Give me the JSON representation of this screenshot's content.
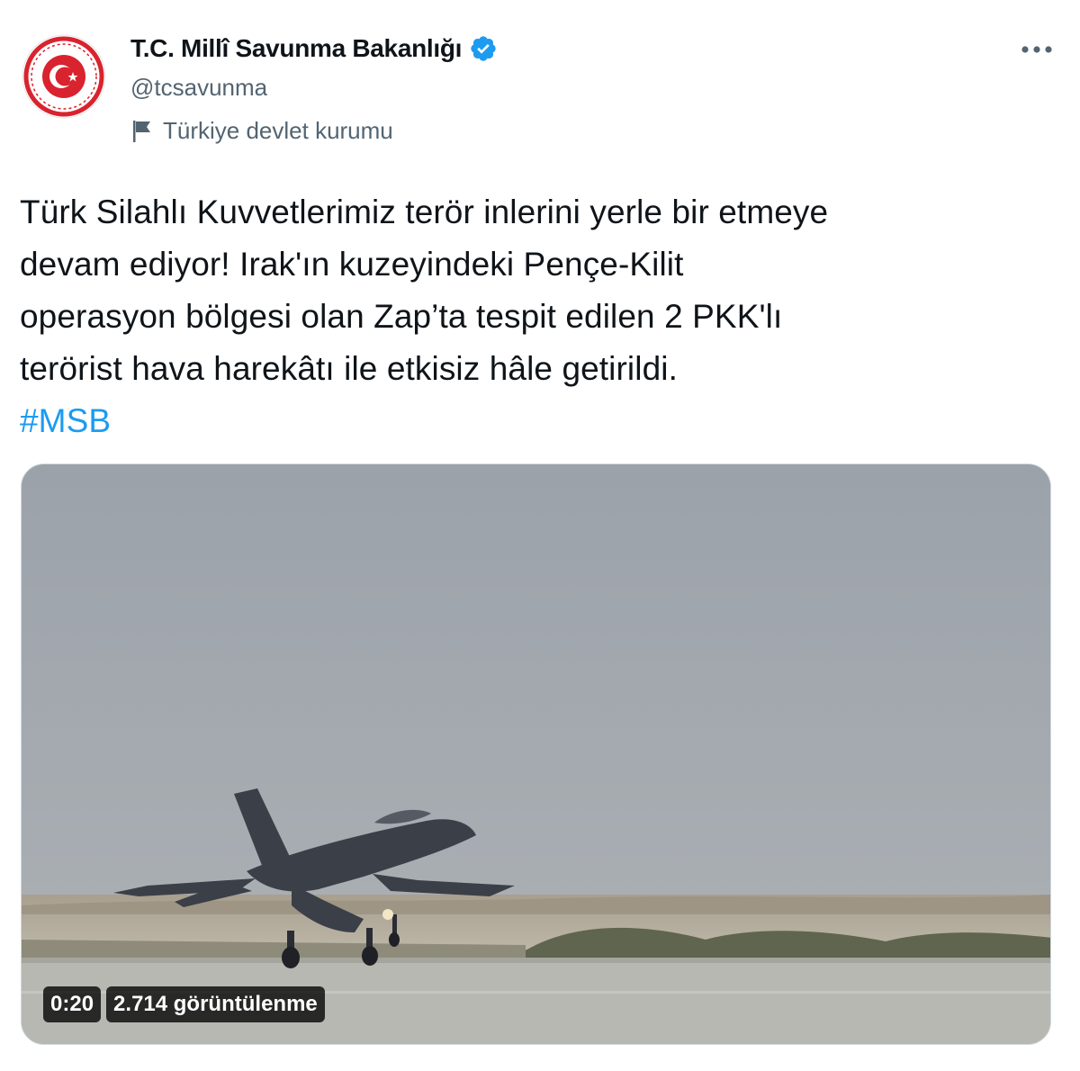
{
  "account": {
    "display_name": "T.C. Millî Savunma Bakanlığı",
    "handle": "@tcsavunma",
    "verified": true,
    "affiliation": "Türkiye devlet kurumu",
    "avatar_icon": "msb-emblem-logo"
  },
  "tweet": {
    "lines": [
      "Türk Silahlı Kuvvetlerimiz terör inlerini yerle bir etmeye",
      "devam ediyor! Irak'ın kuzeyindeki Pençe-Kilit",
      "operasyon bölgesi olan Zap’ta tespit edilen 2 PKK'lı",
      "terörist hava harekâtı ile etkisiz hâle getirildi."
    ],
    "hashtag": "#MSB"
  },
  "media": {
    "type": "video",
    "duration": "0:20",
    "views": "2.714 görüntülenme"
  },
  "icons": {
    "more": "more-options-icon",
    "verified": "verified-badge-icon",
    "flag": "flag-icon"
  },
  "colors": {
    "accent": "#1d9bf0",
    "secondary_text": "#536471",
    "logo_red": "#d9232e"
  }
}
